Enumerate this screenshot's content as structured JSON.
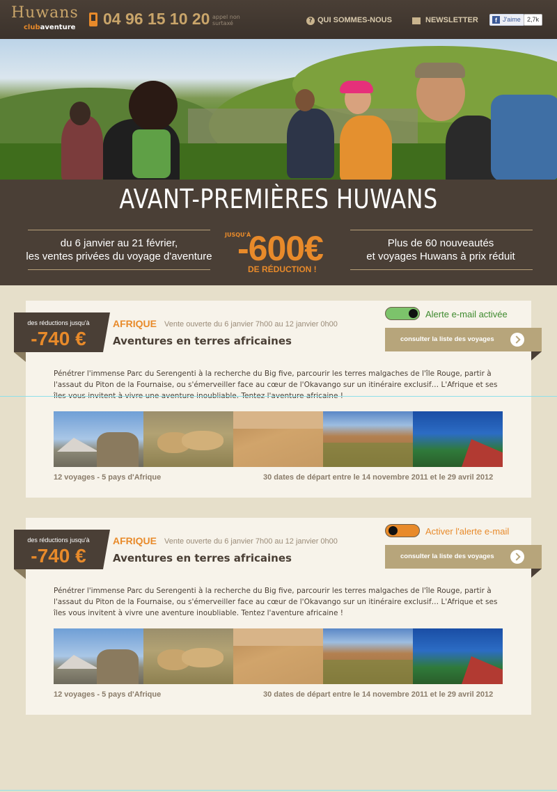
{
  "header": {
    "brand": "Huwans",
    "brand_sub_1": "club",
    "brand_sub_2": "aventure",
    "phone": "04 96 15 10 20",
    "phone_note": "appel non surtaxé",
    "nav": [
      "QUI SOMMES-NOUS",
      "NEWSLETTER"
    ],
    "fb_like": "J'aime",
    "fb_count": "2,7k"
  },
  "promo": {
    "title": "AVANT-PREMIÈRES HUWANS",
    "left_line1": "du 6 janvier au 21 février,",
    "left_line2": "les ventes privées du voyage d'aventure",
    "jusqua": "JUSQU'À",
    "amount": "-600€",
    "reduction": "DE RÉDUCTION !",
    "right_line1": "Plus de 60 nouveautés",
    "right_line2": "et voyages Huwans à prix réduit"
  },
  "cards": [
    {
      "ribbon_lead": "des réductions jusqu'à",
      "ribbon_amount": "-740 €",
      "region": "AFRIQUE",
      "sale_dates": "Vente ouverte du 6 janvier 7h00 au 12 janvier 0h00",
      "title": "Aventures en terres africaines",
      "alert_label": "Alerte e-mail activée",
      "alert_active": true,
      "list_button": "consulter la liste des voyages",
      "description": "Pénétrer l'immense Parc du Serengenti à la recherche du Big five, parcourir les terres malgaches de l'île Rouge, partir à l'assaut du Piton de la Fournaise, ou s'émerveiller face au cœur de l'Okavango sur un itinéraire exclusif… L'Afrique et ses îles vous invitent à vivre une aventure inoubliable. Tentez l'aventure africaine !",
      "stat_left": "12 voyages - 5 pays d'Afrique",
      "stat_right": "30 dates de départ entre le 14 novembre 2011 et le 29 avril 2012"
    },
    {
      "ribbon_lead": "des réductions jusqu'à",
      "ribbon_amount": "-740 €",
      "region": "AFRIQUE",
      "sale_dates": "Vente ouverte du 6 janvier 7h00 au 12 janvier 0h00",
      "title": "Aventures en terres africaines",
      "alert_label": "Activer l'alerte e-mail",
      "alert_active": false,
      "list_button": "consulter la liste des voyages",
      "description": "Pénétrer l'immense Parc du Serengenti à la recherche du Big five, parcourir les terres malgaches de l'île Rouge, partir à l'assaut du Piton de la Fournaise, ou s'émerveiller face au cœur de l'Okavango sur un itinéraire exclusif… L'Afrique et ses îles vous invitent à vivre une aventure inoubliable. Tentez l'aventure africaine !",
      "stat_left": "12 voyages - 5 pays d'Afrique",
      "stat_right": "30 dates de départ entre le 14 novembre 2011 et le 29 avril 2012"
    }
  ],
  "colors": {
    "brown": "#4a3f36",
    "orange": "#e88a2a",
    "tan": "#b7a57b",
    "alert_on": "#7cc36b",
    "alert_on_text": "#3e8a2e"
  }
}
